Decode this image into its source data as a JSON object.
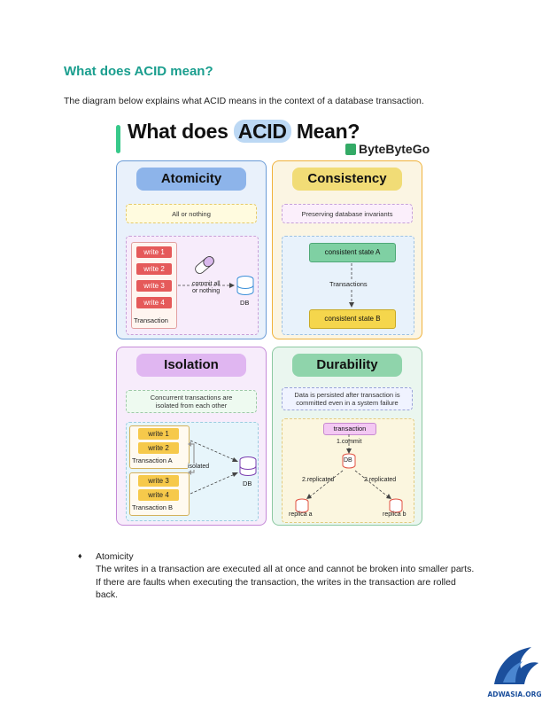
{
  "heading": "What does ACID mean?",
  "intro": "The diagram below explains what ACID means in the context of a database transaction.",
  "diagram": {
    "title_part1": "What does",
    "title_acid": "ACID",
    "title_part2": "Mean?",
    "brand": "ByteByteGo",
    "atomicity": {
      "title": "Atomicity",
      "subtitle": "All or nothing",
      "writes": [
        "write 1",
        "write 2",
        "write 3",
        "write 4"
      ],
      "transaction_label": "Transaction",
      "commit_label_1": "commit all",
      "commit_label_2": "or nothing",
      "db_label": "DB"
    },
    "consistency": {
      "title": "Consistency",
      "subtitle": "Preserving database invariants",
      "state_a": "consistent state A",
      "transactions_label": "Transactions",
      "state_b": "consistent state B"
    },
    "isolation": {
      "title": "Isolation",
      "subtitle_1": "Concurrent transactions are",
      "subtitle_2": "isolated from each other",
      "txn_a_writes": [
        "write 1",
        "write 2"
      ],
      "txn_a_label": "Transaction A",
      "isolated_label": "isolated",
      "txn_b_writes": [
        "write 3",
        "write 4"
      ],
      "txn_b_label": "Transaction B",
      "db_label": "DB"
    },
    "durability": {
      "title": "Durability",
      "subtitle_1": "Data is persisted after transaction is",
      "subtitle_2": "committed even in a system failure",
      "transaction_label": "transaction",
      "commit_label": "1.commit",
      "db_label": "DB",
      "replicated_left": "2.replicated",
      "replicated_right": "2.replicated",
      "replica_a": "replica a",
      "replica_b": "replica b"
    }
  },
  "bullet": {
    "symbol": "♦",
    "title": "Atomicity",
    "text": "The writes in a transaction are executed all at once and cannot be broken into smaller parts. If there are faults when executing the transaction, the writes in the transaction are rolled back."
  },
  "watermark": {
    "text": "ADWASIA.ORG",
    "color": "#1b4f9c"
  }
}
